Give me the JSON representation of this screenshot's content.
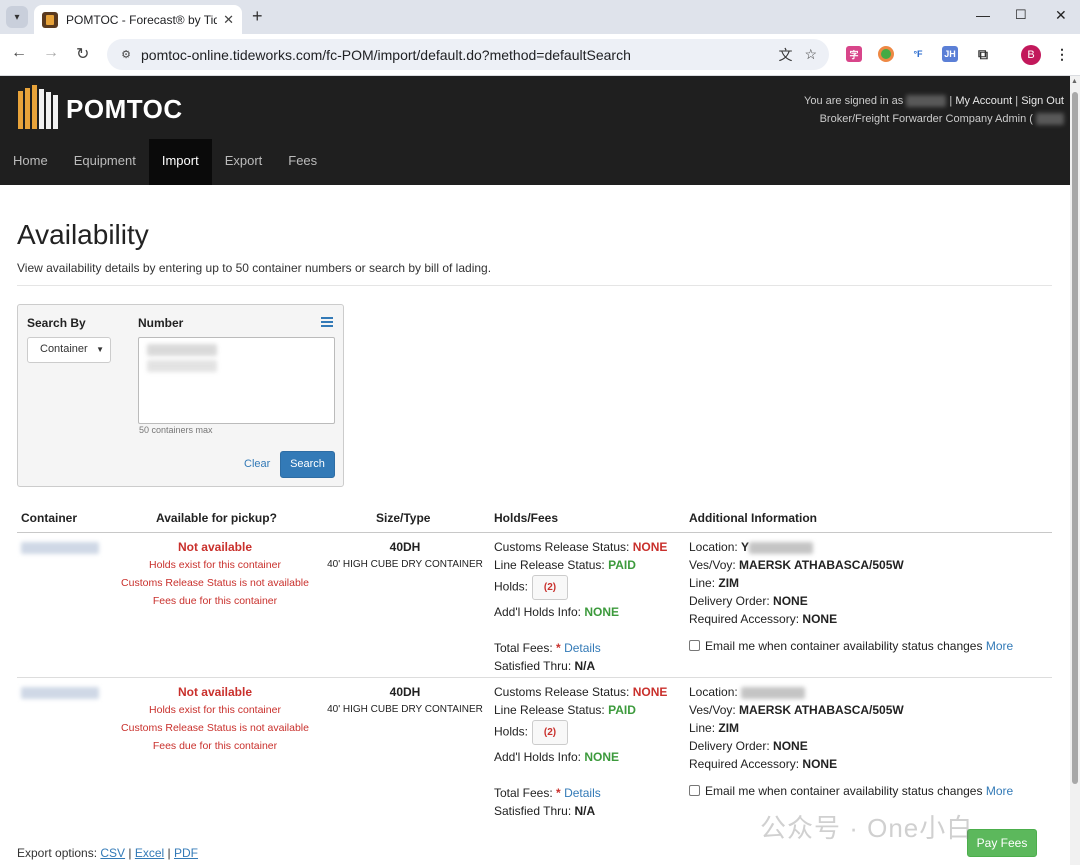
{
  "browser": {
    "tab_title": "POMTOC - Forecast® by Tid",
    "url": "pomtoc-online.tideworks.com/fc-POM/import/default.do?method=defaultSearch",
    "profile_initial": "B",
    "new_tab": "+",
    "tab_close": "✕"
  },
  "site": {
    "logo": "POMTOC",
    "signed_in_prefix": "You are signed in as",
    "my_account": "My Account",
    "sign_out": "Sign Out",
    "role": "Broker/Freight Forwarder Company Admin (",
    "nav": [
      "Home",
      "Equipment",
      "Import",
      "Export",
      "Fees"
    ],
    "active_nav": "Import"
  },
  "page": {
    "title": "Availability",
    "description": "View availability details by entering up to 50 container numbers or search by bill of lading."
  },
  "search": {
    "search_by_label": "Search By",
    "search_by_value": "Container",
    "number_label": "Number",
    "hint": "50 containers max",
    "clear": "Clear",
    "search": "Search"
  },
  "table": {
    "headers": [
      "Container",
      "Available for pickup?",
      "Size/Type",
      "Holds/Fees",
      "Additional Information"
    ],
    "rows": [
      {
        "availability": "Not available",
        "notes": [
          "Holds exist for this container",
          "Customs Release Status is not available",
          "Fees due for this container"
        ],
        "size_code": "40DH",
        "size_desc": "40' HIGH CUBE DRY CONTAINER",
        "customs_label": "Customs Release Status:",
        "customs_value": "NONE",
        "line_label": "Line Release Status:",
        "line_value": "PAID",
        "holds_label": "Holds:",
        "holds_count": "(2)",
        "addl_holds_label": "Add'l Holds Info:",
        "addl_holds_value": "NONE",
        "total_fees_label": "Total Fees:",
        "total_fees_star": "*",
        "details": "Details",
        "satisfied_label": "Satisfied Thru:",
        "satisfied_value": "N/A",
        "location_label": "Location:",
        "location_value": "Y",
        "vesvoy_label": "Ves/Voy:",
        "vesvoy_value": "MAERSK ATHABASCA/505W",
        "line_label2": "Line:",
        "line_value2": "ZIM",
        "delivery_label": "Delivery Order:",
        "delivery_value": "NONE",
        "accessory_label": "Required Accessory:",
        "accessory_value": "NONE",
        "email_label": "Email me when container availability status changes",
        "more": "More"
      },
      {
        "availability": "Not available",
        "notes": [
          "Holds exist for this container",
          "Customs Release Status is not available",
          "Fees due for this container"
        ],
        "size_code": "40DH",
        "size_desc": "40' HIGH CUBE DRY CONTAINER",
        "customs_label": "Customs Release Status:",
        "customs_value": "NONE",
        "line_label": "Line Release Status:",
        "line_value": "PAID",
        "holds_label": "Holds:",
        "holds_count": "(2)",
        "addl_holds_label": "Add'l Holds Info:",
        "addl_holds_value": "NONE",
        "total_fees_label": "Total Fees:",
        "total_fees_star": "*",
        "details": "Details",
        "satisfied_label": "Satisfied Thru:",
        "satisfied_value": "N/A",
        "location_label": "Location:",
        "location_value": "",
        "vesvoy_label": "Ves/Voy:",
        "vesvoy_value": "MAERSK ATHABASCA/505W",
        "line_label2": "Line:",
        "line_value2": "ZIM",
        "delivery_label": "Delivery Order:",
        "delivery_value": "NONE",
        "accessory_label": "Required Accessory:",
        "accessory_value": "NONE",
        "email_label": "Email me when container availability status changes",
        "more": "More"
      }
    ]
  },
  "footer": {
    "export_label": "Export options:",
    "csv": "CSV",
    "excel": "Excel",
    "pdf": "PDF",
    "pay_fees": "Pay Fees",
    "watermark": "公众号 · One小白"
  },
  "icons": {
    "list": "list-icon",
    "translate": "translate-icon",
    "star": "star-icon",
    "extensions": "puzzle-icon",
    "menu": "kebab-menu-icon"
  },
  "colors": {
    "header_bg": "#1f1f1f",
    "logo_accent": "#e8a33a",
    "link": "#337ab7",
    "error": "#c9302c",
    "success": "#3c9a3c",
    "primary_button": "#337ab7",
    "pay_button": "#5cb85c"
  }
}
